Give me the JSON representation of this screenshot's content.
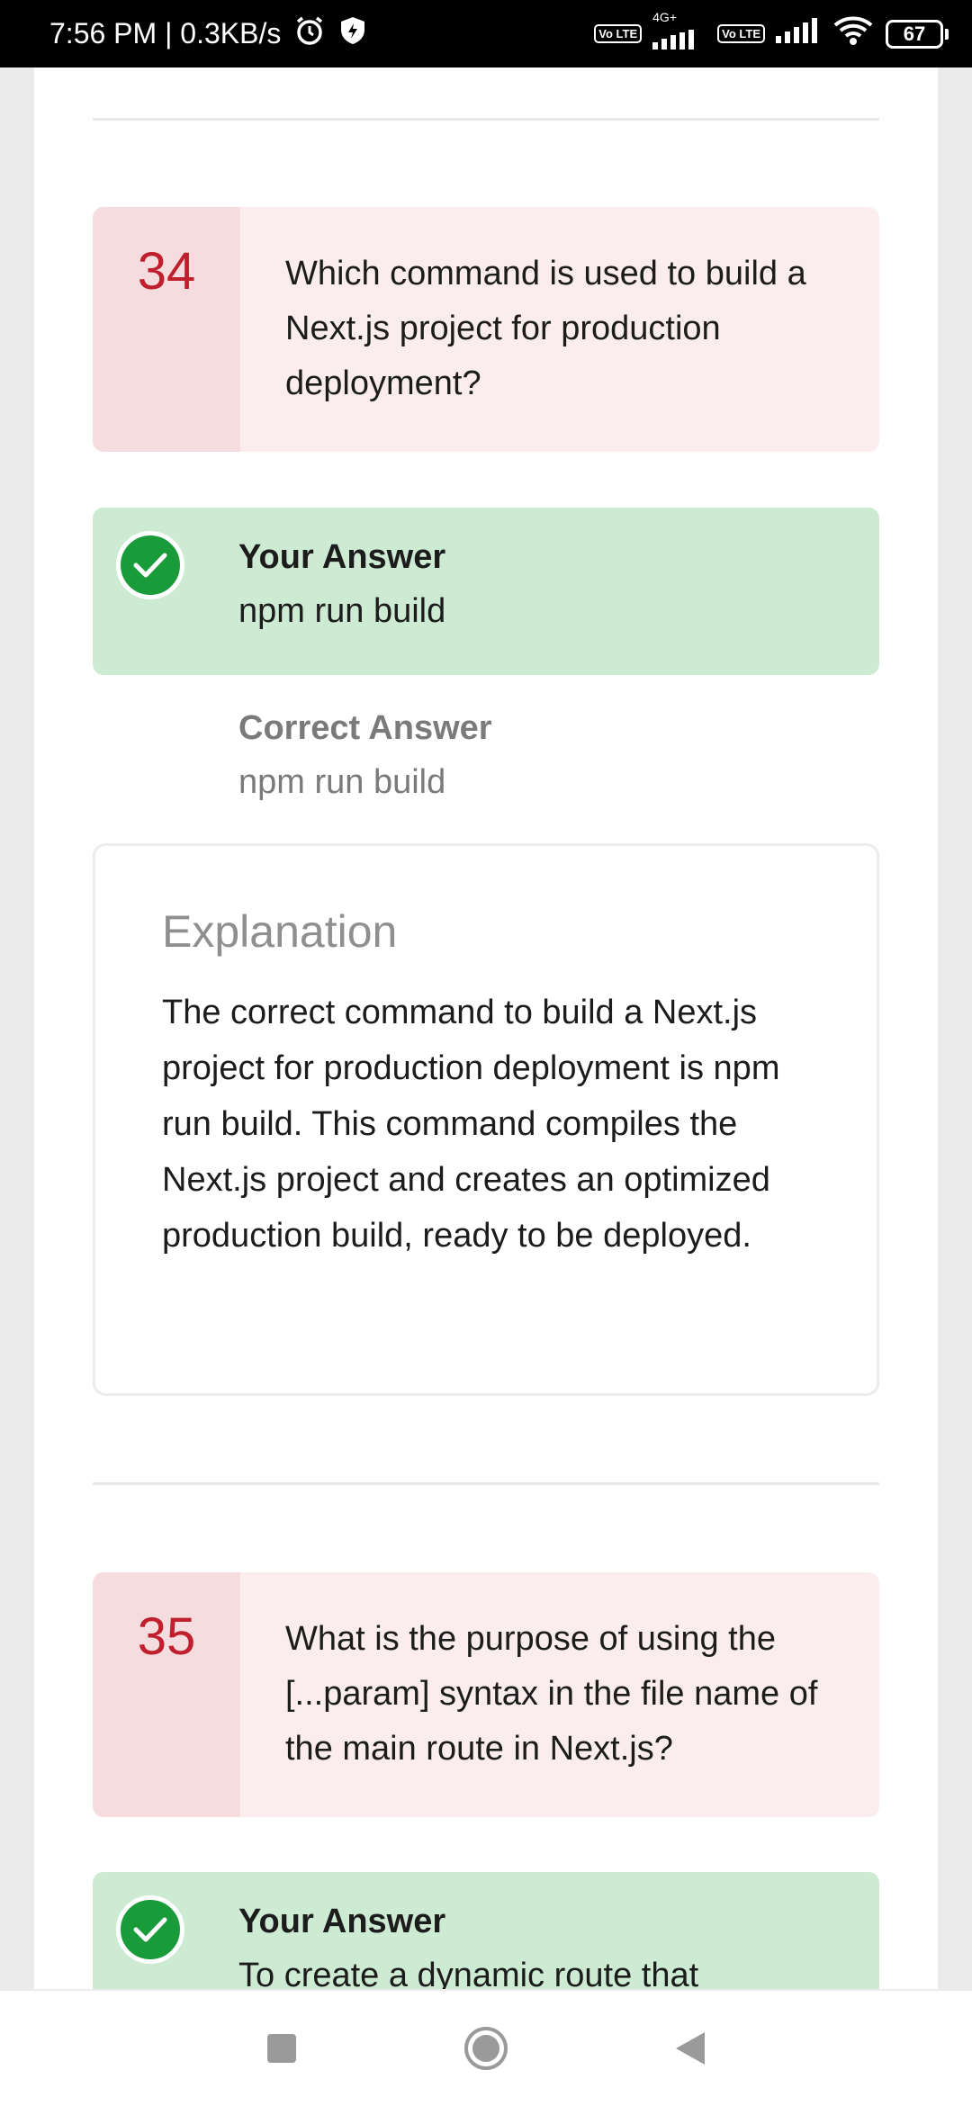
{
  "status_bar": {
    "time": "7:56 PM | 0.3KB/s",
    "volte1": "Vo LTE",
    "net_type": "4G+",
    "volte2": "Vo LTE",
    "battery": "67"
  },
  "questions": [
    {
      "number": "34",
      "text": "Which command is used to build a Next.js project for production deployment?",
      "your_answer_label": "Your Answer",
      "your_answer": "npm run build",
      "correct_answer_label": "Correct Answer",
      "correct_answer": "npm run build",
      "explanation_title": "Explanation",
      "explanation": "The correct command to build a Next.js project for production deployment is npm run build. This command compiles the Next.js project and creates an optimized production build, ready to be deployed."
    },
    {
      "number": "35",
      "text": "What is the purpose of using the [...param] syntax in the file name of the main route in Next.js?",
      "your_answer_label": "Your Answer",
      "your_answer": "To create a dynamic route that"
    }
  ],
  "colors": {
    "accent_red": "#c0202d",
    "answer_green_bg": "#cdebd3",
    "check_green": "#1a9b3a"
  }
}
